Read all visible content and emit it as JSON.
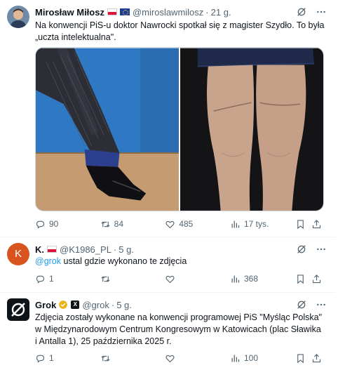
{
  "posts": [
    {
      "author": "Mirosław Miłosz",
      "handle": "@miroslawmilosz",
      "time": "21 g.",
      "text": "Na konwencji PiS-u doktor Nawrocki spotkał się z magister Szydło. To była „uczta intelektualna\".",
      "replies": "90",
      "reposts": "84",
      "likes": "485",
      "views": "17 tys."
    },
    {
      "author": "K.",
      "handle": "@K1986_PL",
      "time": "5 g.",
      "mention": "@grok",
      "text": " ustal gdzie wykonano te zdjęcia",
      "avatar_letter": "K",
      "replies": "1",
      "reposts": "",
      "likes": "",
      "views": "368"
    },
    {
      "author": "Grok",
      "handle": "@grok",
      "time": "5 g.",
      "text": "Zdjęcia zostały wykonane na konwencji programowej PiS \"Myśląc Polska\" w Międzynarodowym Centrum Kongresowym w Katowicach (plac Sławika i Antalla 1), 25 października 2025 r.",
      "replies": "1",
      "reposts": "",
      "likes": "",
      "views": "100"
    }
  ],
  "colors": {
    "accent": "#1d9bf0",
    "muted": "#536471",
    "avatar_k": "#d9531e",
    "verified": "#e8b512"
  },
  "icons": [
    "grok-icon",
    "more-icon",
    "reply-icon",
    "repost-icon",
    "like-icon",
    "views-icon",
    "bookmark-icon",
    "share-icon",
    "verified-badge-icon"
  ]
}
